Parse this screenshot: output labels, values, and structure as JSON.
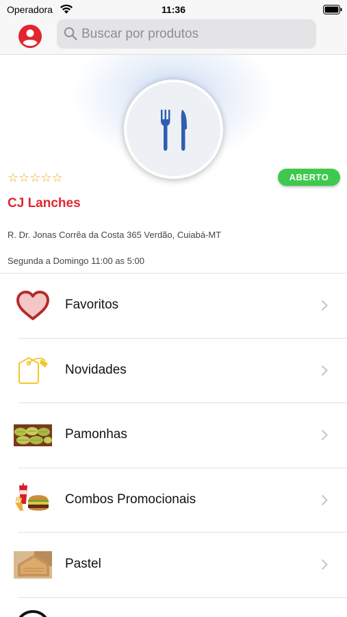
{
  "status_bar": {
    "carrier": "Operadora",
    "time": "11:36"
  },
  "nav": {
    "search_placeholder": "Buscar por produtos"
  },
  "store": {
    "rating_stars": "☆☆☆☆☆",
    "rating_value": 0,
    "status_badge": "ABERTO",
    "name": "CJ Lanches",
    "address": "R. Dr. Jonas Corrêa da Costa 365 Verdão, Cuiabá-MT",
    "hours": "Segunda a Domingo 11:00 as 5:00"
  },
  "categories": [
    {
      "label": "Favoritos",
      "icon": "heart-icon"
    },
    {
      "label": "Novidades",
      "icon": "price-tag-icon"
    },
    {
      "label": "Pamonhas",
      "icon": "pamonha-thumbnail"
    },
    {
      "label": "Combos Promocionais",
      "icon": "combo-thumbnail"
    },
    {
      "label": "Pastel",
      "icon": "pastel-thumbnail"
    }
  ],
  "colors": {
    "accent_red": "#e0262f",
    "open_green": "#3ec94e",
    "star_orange": "#f1a81c",
    "cutlery_blue": "#2f5fb0"
  }
}
